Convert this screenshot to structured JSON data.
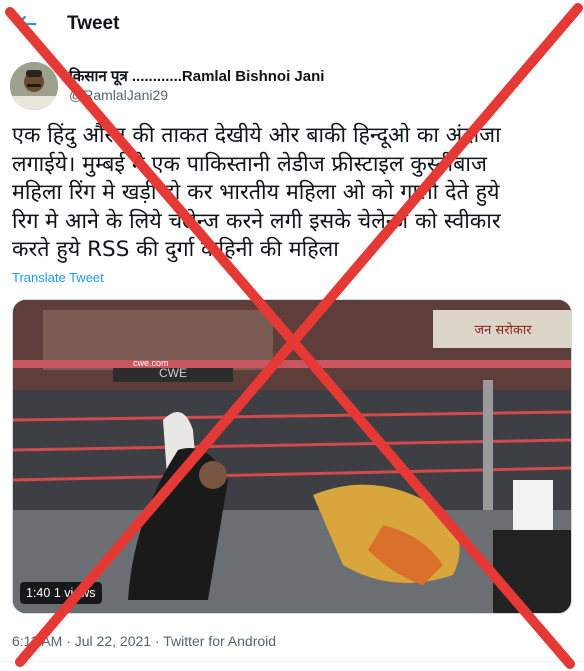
{
  "header": {
    "title": "Tweet"
  },
  "tweet": {
    "author_name": "किसान पूत्र ............Ramlal Bishnoi Jani",
    "author_handle": "@RamlalJani29",
    "lines": [
      "एक हिंदु औरत की ताकत देखीये ओर बाकी हिन्दूओ का अंदाजा",
      "लगाईये।   मुम्बई मे एक पाकिस्तानी लेडीज फ्रीस्टाइल कुस्तीबाज",
      "महिला रिंग मे खड़ी हो कर भारतीय महिला ओ को गाली देते हुये",
      "रिग मे आने के लिये चेलेन्ज करने लगी इसके चेलेन्ज को स्वीकार",
      "करते हुये RSS  की दुर्गा वाहिनी की महिला"
    ],
    "translate_label": "Translate Tweet",
    "video": {
      "duration": "1:40",
      "views": "1 views",
      "overlay_text": "जन सरोकार",
      "banner_text": "CWE",
      "sign_text": "cwe.com"
    },
    "meta": "6:11 AM · Jul 22, 2021 · Twitter for Android"
  },
  "icons": {
    "back": "arrow-left-icon",
    "cross": "red-x-mark"
  },
  "colors": {
    "accent": "#1d9bf0",
    "cross": "#e53935",
    "secondary_text": "#536471"
  }
}
